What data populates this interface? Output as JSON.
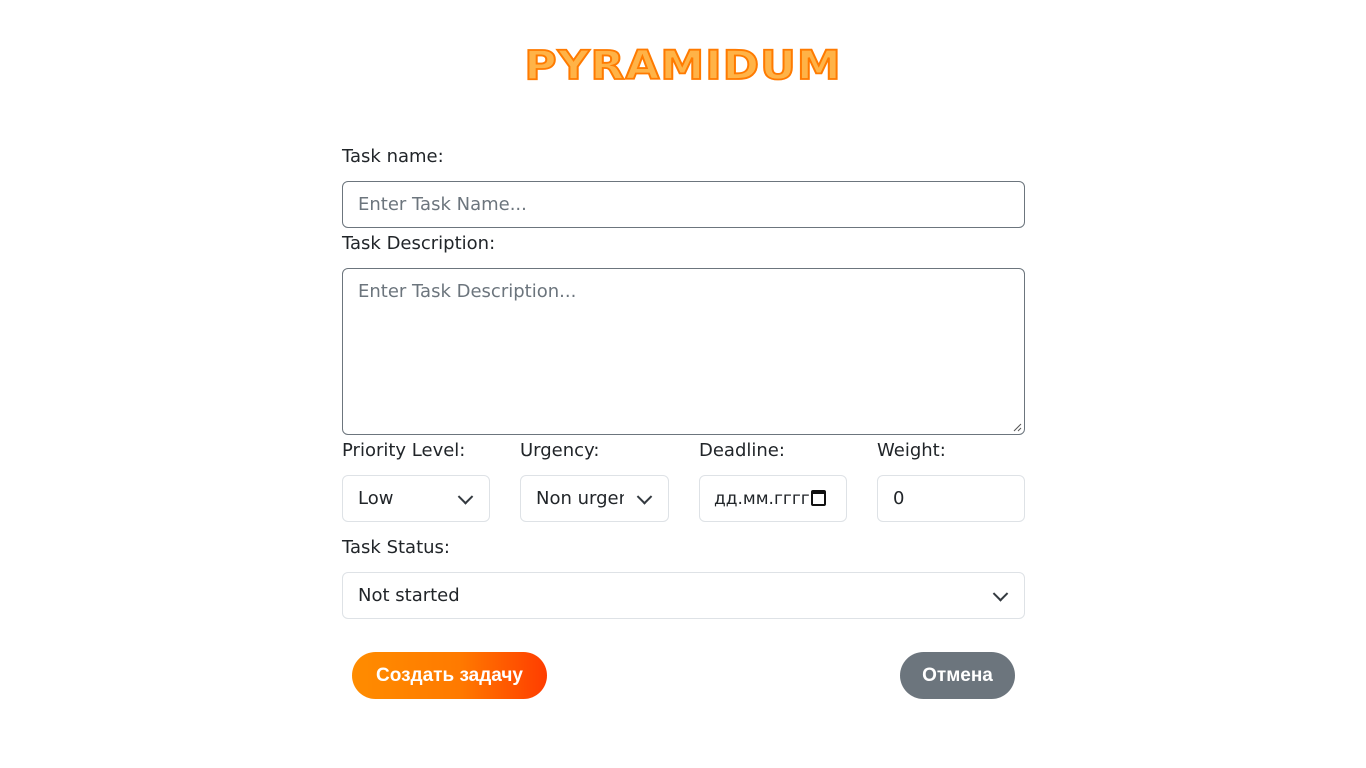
{
  "logo": {
    "text": "PYRAMIDUM"
  },
  "form": {
    "task_name": {
      "label": "Task name:",
      "placeholder": "Enter Task Name..."
    },
    "task_description": {
      "label": "Task Description:",
      "placeholder": "Enter Task Description..."
    },
    "priority": {
      "label": "Priority Level:",
      "value": "Low"
    },
    "urgency": {
      "label": "Urgency:",
      "value": "Non urgent"
    },
    "deadline": {
      "label": "Deadline:",
      "value": "дд.мм.гггг"
    },
    "weight": {
      "label": "Weight:",
      "value": "0"
    },
    "status": {
      "label": "Task Status:",
      "value": "Not started"
    }
  },
  "buttons": {
    "create_label": "Создать задачу",
    "cancel_label": "Отмена"
  },
  "colors": {
    "brand_orange": "#ff7a00",
    "cancel_gray": "#6c757d"
  },
  "icons": [
    "chevron-down-icon",
    "calendar-icon",
    "resize-handle-icon"
  ]
}
